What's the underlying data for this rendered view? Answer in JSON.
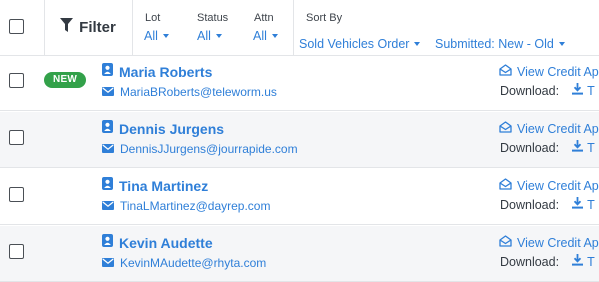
{
  "toolbar": {
    "filter_label": "Filter",
    "filters": [
      {
        "title": "Lot",
        "value": "All"
      },
      {
        "title": "Status",
        "value": "All"
      },
      {
        "title": "Attn",
        "value": "All"
      }
    ],
    "sort": {
      "title": "Sort By",
      "field": "Sold Vehicles Order",
      "order": "Submitted: New - Old"
    }
  },
  "rows": [
    {
      "badge": "NEW",
      "name": "Maria Roberts",
      "email": "MariaBRoberts@teleworm.us",
      "credit_link": "View Credit Ap",
      "download_label": "Download:",
      "download_link": "T"
    },
    {
      "badge": "",
      "name": "Dennis Jurgens",
      "email": "DennisJJurgens@jourrapide.com",
      "credit_link": "View Credit Ap",
      "download_label": "Download:",
      "download_link": "T"
    },
    {
      "badge": "",
      "name": "Tina Martinez",
      "email": "TinaLMartinez@dayrep.com",
      "credit_link": "View Credit Ap",
      "download_label": "Download:",
      "download_link": "T"
    },
    {
      "badge": "",
      "name": "Kevin Audette",
      "email": "KevinMAudette@rhyta.com",
      "credit_link": "View Credit Ap",
      "download_label": "Download:",
      "download_link": "T"
    }
  ],
  "colors": {
    "accent": "#2f7fd8",
    "badge": "#33a14a",
    "text": "#333a42"
  },
  "icons": [
    "filter-icon",
    "person-icon",
    "envelope-icon",
    "open-envelope-icon",
    "download-icon"
  ]
}
